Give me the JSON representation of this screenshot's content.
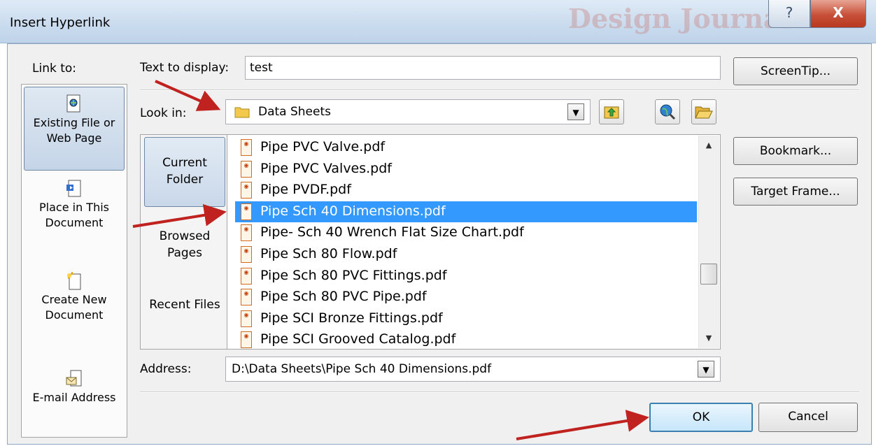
{
  "window": {
    "title": "Insert Hyperlink",
    "background_brand_text": "Design Journal",
    "help_glyph": "?",
    "close_glyph": "X"
  },
  "link_to": {
    "label": "Link to:",
    "items": [
      {
        "label": "Existing File or Web Page",
        "icon": "existing-file-icon",
        "selected": true
      },
      {
        "label": "Place in This Document",
        "icon": "place-in-document-icon",
        "selected": false
      },
      {
        "label": "Create New Document",
        "icon": "new-document-icon",
        "selected": false
      },
      {
        "label": "E-mail Address",
        "icon": "email-icon",
        "selected": false
      }
    ]
  },
  "text_to_display": {
    "label": "Text to display:",
    "value": "test"
  },
  "look_in": {
    "label": "Look in:",
    "value": "Data Sheets"
  },
  "places": [
    {
      "label": "Current Folder",
      "selected": true
    },
    {
      "label": "Browsed Pages",
      "selected": false
    },
    {
      "label": "Recent Files",
      "selected": false
    }
  ],
  "files": [
    {
      "name": "Pipe PVC Valve.pdf",
      "selected": false
    },
    {
      "name": "Pipe PVC Valves.pdf",
      "selected": false
    },
    {
      "name": "Pipe PVDF.pdf",
      "selected": false
    },
    {
      "name": "Pipe Sch 40 Dimensions.pdf",
      "selected": true
    },
    {
      "name": "Pipe- Sch 40 Wrench Flat Size Chart.pdf",
      "selected": false
    },
    {
      "name": "Pipe Sch 80 Flow.pdf",
      "selected": false
    },
    {
      "name": "Pipe Sch 80 PVC Fittings.pdf",
      "selected": false
    },
    {
      "name": "Pipe Sch 80 PVC Pipe.pdf",
      "selected": false
    },
    {
      "name": "Pipe SCI Bronze Fittings.pdf",
      "selected": false
    },
    {
      "name": "Pipe SCI Grooved Catalog.pdf",
      "selected": false
    }
  ],
  "address": {
    "label": "Address:",
    "value": "D:\\Data Sheets\\Pipe Sch 40 Dimensions.pdf"
  },
  "buttons": {
    "screentip": "ScreenTip...",
    "bookmark": "Bookmark...",
    "target_frame": "Target Frame...",
    "ok": "OK",
    "cancel": "Cancel"
  },
  "colors": {
    "selection": "#3399ff",
    "annotation_arrow": "#c0221f"
  }
}
